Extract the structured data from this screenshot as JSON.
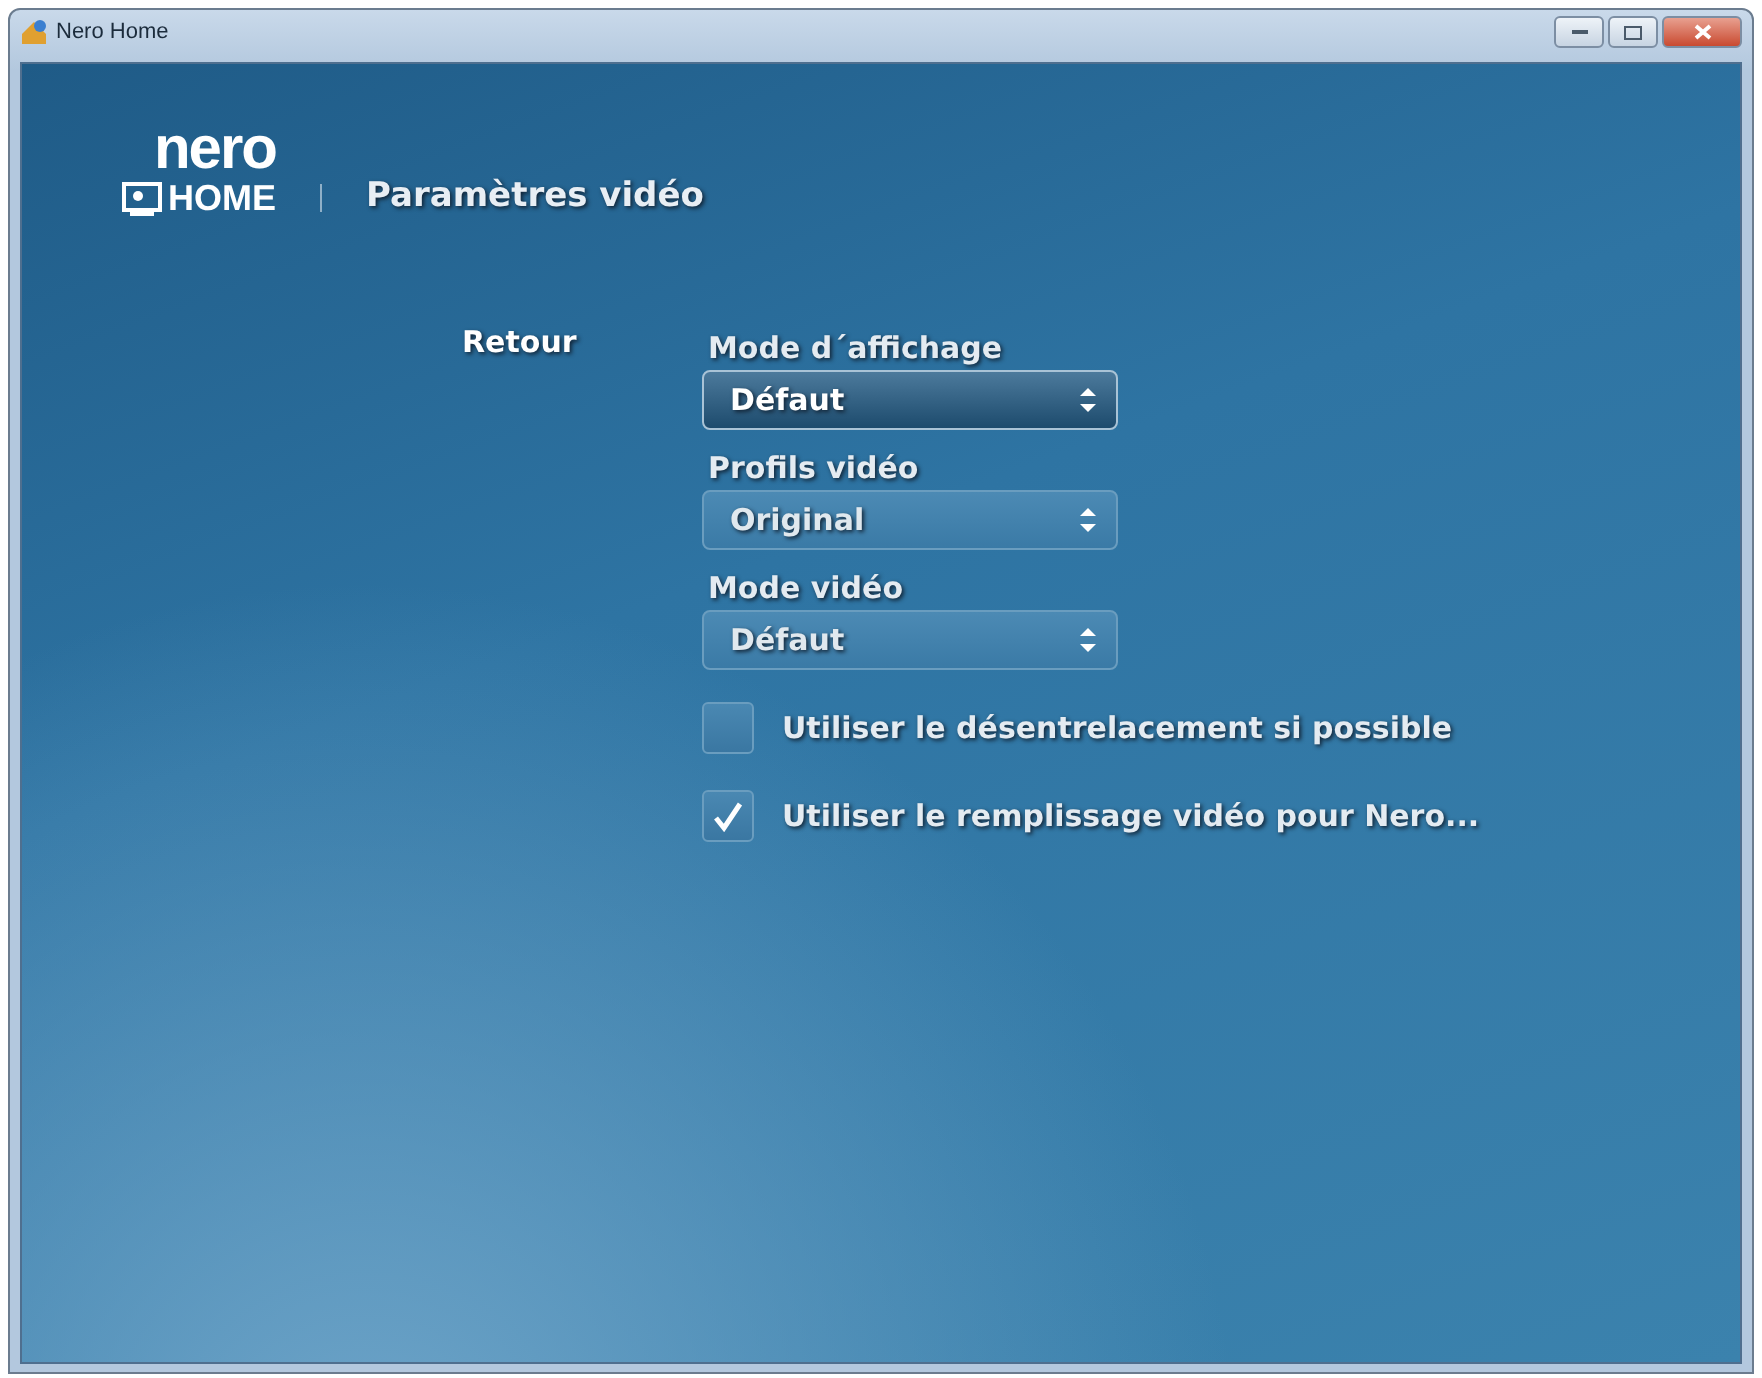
{
  "window": {
    "title": "Nero Home"
  },
  "logo": {
    "top": "nero",
    "bottom": "HOME"
  },
  "page_title": "Paramètres vidéo",
  "back_link": "Retour",
  "settings": [
    {
      "kind": "dropdown",
      "label": "Mode d´affichage",
      "value": "Défaut",
      "focused": true
    },
    {
      "kind": "dropdown",
      "label": "Profils vidéo",
      "value": "Original",
      "focused": false
    },
    {
      "kind": "dropdown",
      "label": "Mode vidéo",
      "value": "Défaut",
      "focused": false
    },
    {
      "kind": "checkbox",
      "label": "Utiliser le désentrelacement si possible",
      "checked": false
    },
    {
      "kind": "checkbox",
      "label": "Utiliser le remplissage vidéo pour Nero...",
      "checked": true
    }
  ]
}
